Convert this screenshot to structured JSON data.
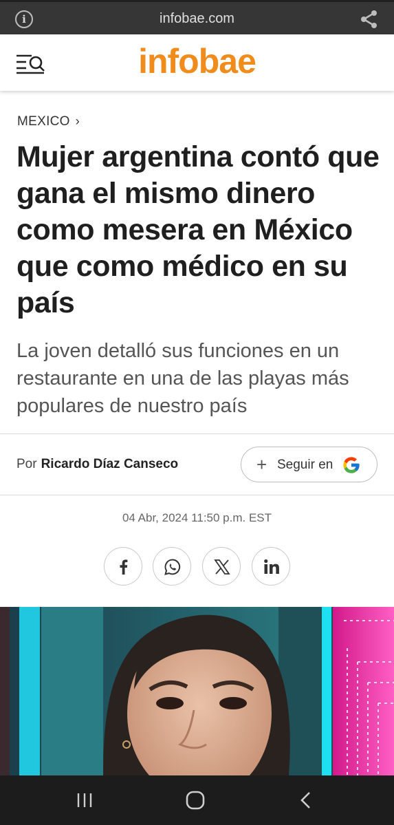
{
  "browser": {
    "url": "infobae.com",
    "info_icon": "info-icon",
    "share_icon": "share-icon"
  },
  "header": {
    "logo": "infobae",
    "logo_color": "#f08c1c",
    "menu_icon": "menu-search-icon"
  },
  "article": {
    "section": "MEXICO",
    "section_chevron": "›",
    "title": "Mujer argentina contó que gana el mismo dinero como mesera en México que como médico en su país",
    "subtitle": "La joven detalló sus funciones en un restaurante en una de las playas más populares de nuestro país",
    "author_prefix": "Por",
    "author_name": "Ricardo Díaz Canseco",
    "follow_label": "Seguir en",
    "follow_icon": "google-icon",
    "date": "04 Abr, 2024 11:50 p.m. EST"
  },
  "share_buttons": [
    {
      "icon": "facebook-icon"
    },
    {
      "icon": "whatsapp-icon"
    },
    {
      "icon": "x-icon"
    },
    {
      "icon": "linkedin-icon"
    }
  ],
  "system_nav": {
    "recent_icon": "recent-apps-icon",
    "home_icon": "home-icon",
    "back_icon": "back-icon"
  }
}
